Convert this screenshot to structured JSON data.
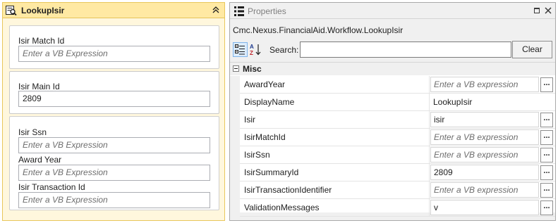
{
  "activity": {
    "title": "LookupIsir",
    "fields": [
      {
        "label": "Isir Match Id",
        "value": "",
        "placeholder": "Enter a VB Expression"
      },
      {
        "label": "Isir Main Id",
        "value": "2809",
        "placeholder": ""
      },
      {
        "label": "Isir Ssn",
        "value": "",
        "placeholder": "Enter a VB Expression"
      },
      {
        "label": "Award Year",
        "value": "",
        "placeholder": "Enter a VB Expression"
      },
      {
        "label": "Isir Transaction Id",
        "value": "",
        "placeholder": "Enter a VB Expression"
      }
    ]
  },
  "properties": {
    "title": "Properties",
    "type_name": "Cmc.Nexus.FinancialAid.Workflow.LookupIsir",
    "search_label": "Search:",
    "search_value": "",
    "clear_label": "Clear",
    "category": "Misc",
    "rows": [
      {
        "name": "AwardYear",
        "value": "Enter a VB expression",
        "hint": true,
        "has_button": true
      },
      {
        "name": "DisplayName",
        "value": "LookupIsir",
        "hint": false,
        "has_button": false
      },
      {
        "name": "Isir",
        "value": "isir",
        "hint": false,
        "has_button": true
      },
      {
        "name": "IsirMatchId",
        "value": "Enter a VB expression",
        "hint": true,
        "has_button": true
      },
      {
        "name": "IsirSsn",
        "value": "Enter a VB expression",
        "hint": true,
        "has_button": true
      },
      {
        "name": "IsirSummaryId",
        "value": "2809",
        "hint": false,
        "has_button": true
      },
      {
        "name": "IsirTransactionIdentifier",
        "value": "Enter a VB expression",
        "hint": true,
        "has_button": true
      },
      {
        "name": "ValidationMessages",
        "value": "v",
        "hint": false,
        "has_button": true
      }
    ],
    "ellipsis_label": "..."
  },
  "icons": {
    "activity": "lookup-activity-icon",
    "collapse": "double-chevron-up-icon",
    "properties": "properties-grid-icon",
    "restore": "restore-window-icon",
    "close": "close-icon",
    "categorized": "categorized-view-icon",
    "alphabetical": "alphabetical-sort-icon"
  },
  "colors": {
    "activity_background": "#fff7dd",
    "activity_header": "#ffe9a3",
    "activity_border": "#e8c75b",
    "panel_background": "#f0f0f0",
    "hint_text": "#6d6d6d"
  }
}
